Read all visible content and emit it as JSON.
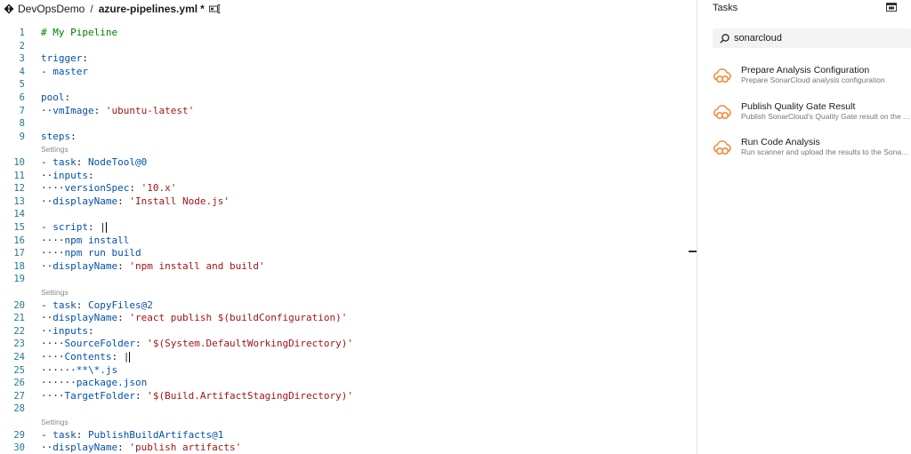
{
  "header": {
    "project": "DevOpsDemo",
    "separator": "/",
    "file_name": "azure-pipelines.yml",
    "dirty_marker": "*"
  },
  "editor": {
    "lines": [
      {
        "n": "1",
        "parts": [
          [
            "comment",
            "# My Pipeline"
          ]
        ]
      },
      {
        "n": "2",
        "parts": []
      },
      {
        "n": "3",
        "parts": [
          [
            "key",
            "trigger"
          ],
          [
            "plain",
            ":"
          ]
        ]
      },
      {
        "n": "4",
        "parts": [
          [
            "plain",
            "- "
          ],
          [
            "val",
            "master"
          ]
        ]
      },
      {
        "n": "5",
        "parts": []
      },
      {
        "n": "6",
        "parts": [
          [
            "key",
            "pool"
          ],
          [
            "plain",
            ":"
          ]
        ]
      },
      {
        "n": "7",
        "parts": [
          [
            "ws",
            "··"
          ],
          [
            "key",
            "vmImage"
          ],
          [
            "plain",
            ": "
          ],
          [
            "str",
            "'ubuntu-latest'"
          ]
        ]
      },
      {
        "n": "8",
        "parts": []
      },
      {
        "n": "9",
        "parts": [
          [
            "key",
            "steps"
          ],
          [
            "plain",
            ":"
          ]
        ]
      },
      {
        "lens": "Settings"
      },
      {
        "n": "10",
        "parts": [
          [
            "plain",
            "- "
          ],
          [
            "key",
            "task"
          ],
          [
            "plain",
            ": "
          ],
          [
            "val",
            "NodeTool@0"
          ]
        ]
      },
      {
        "n": "11",
        "parts": [
          [
            "ws",
            "··"
          ],
          [
            "key",
            "inputs"
          ],
          [
            "plain",
            ":"
          ]
        ]
      },
      {
        "n": "12",
        "parts": [
          [
            "ws",
            "····"
          ],
          [
            "key",
            "versionSpec"
          ],
          [
            "plain",
            ": "
          ],
          [
            "str",
            "'10.x'"
          ]
        ]
      },
      {
        "n": "13",
        "parts": [
          [
            "ws",
            "··"
          ],
          [
            "key",
            "displayName"
          ],
          [
            "plain",
            ": "
          ],
          [
            "str",
            "'Install Node.js'"
          ]
        ]
      },
      {
        "n": "14",
        "parts": []
      },
      {
        "n": "15",
        "parts": [
          [
            "plain",
            "- "
          ],
          [
            "key",
            "script"
          ],
          [
            "plain",
            ": |"
          ]
        ]
      },
      {
        "n": "16",
        "parts": [
          [
            "ws",
            "····"
          ],
          [
            "val",
            "npm install"
          ]
        ]
      },
      {
        "n": "17",
        "parts": [
          [
            "ws",
            "····"
          ],
          [
            "val",
            "npm run build"
          ]
        ]
      },
      {
        "n": "18",
        "parts": [
          [
            "ws",
            "··"
          ],
          [
            "key",
            "displayName"
          ],
          [
            "plain",
            ": "
          ],
          [
            "str",
            "'npm install and build'"
          ]
        ]
      },
      {
        "n": "19",
        "parts": []
      },
      {
        "lens": "Settings"
      },
      {
        "n": "20",
        "parts": [
          [
            "plain",
            "- "
          ],
          [
            "key",
            "task"
          ],
          [
            "plain",
            ": "
          ],
          [
            "val",
            "CopyFiles@2"
          ]
        ]
      },
      {
        "n": "21",
        "parts": [
          [
            "ws",
            "··"
          ],
          [
            "key",
            "displayName"
          ],
          [
            "plain",
            ": "
          ],
          [
            "str",
            "'react publish $(buildConfiguration)'"
          ]
        ]
      },
      {
        "n": "22",
        "parts": [
          [
            "ws",
            "··"
          ],
          [
            "key",
            "inputs"
          ],
          [
            "plain",
            ":"
          ]
        ]
      },
      {
        "n": "23",
        "parts": [
          [
            "ws",
            "····"
          ],
          [
            "key",
            "SourceFolder"
          ],
          [
            "plain",
            ": "
          ],
          [
            "str",
            "'$(System.DefaultWorkingDirectory)'"
          ]
        ]
      },
      {
        "n": "24",
        "parts": [
          [
            "ws",
            "····"
          ],
          [
            "key",
            "Contents"
          ],
          [
            "plain",
            ": |"
          ]
        ]
      },
      {
        "n": "25",
        "parts": [
          [
            "ws",
            "······"
          ],
          [
            "val",
            "**\\*.js"
          ]
        ]
      },
      {
        "n": "26",
        "parts": [
          [
            "ws",
            "······"
          ],
          [
            "val",
            "package.json"
          ]
        ]
      },
      {
        "n": "27",
        "parts": [
          [
            "ws",
            "····"
          ],
          [
            "key",
            "TargetFolder"
          ],
          [
            "plain",
            ": "
          ],
          [
            "str",
            "'$(Build.ArtifactStagingDirectory)'"
          ]
        ]
      },
      {
        "n": "28",
        "parts": []
      },
      {
        "lens": "Settings"
      },
      {
        "n": "29",
        "parts": [
          [
            "plain",
            "- "
          ],
          [
            "key",
            "task"
          ],
          [
            "plain",
            ": "
          ],
          [
            "val",
            "PublishBuildArtifacts@1"
          ]
        ]
      },
      {
        "n": "30",
        "parts": [
          [
            "ws",
            "··"
          ],
          [
            "key",
            "displayName"
          ],
          [
            "plain",
            ": "
          ],
          [
            "str",
            "'publish artifacts'"
          ]
        ]
      }
    ]
  },
  "tasks_panel": {
    "title": "Tasks",
    "search_value": "sonarcloud",
    "accent_color": "#f08d3c",
    "items": [
      {
        "name": "Prepare Analysis Configuration",
        "description": "Prepare SonarCloud analysis configuration",
        "icon": "sonarcloud-icon"
      },
      {
        "name": "Publish Quality Gate Result",
        "description": "Publish SonarCloud's Quality Gate result on the Azure DevOps build result",
        "icon": "sonarcloud-icon"
      },
      {
        "name": "Run Code Analysis",
        "description": "Run scanner and upload the results to the SonarCloud server.",
        "icon": "sonarcloud-icon"
      }
    ]
  }
}
